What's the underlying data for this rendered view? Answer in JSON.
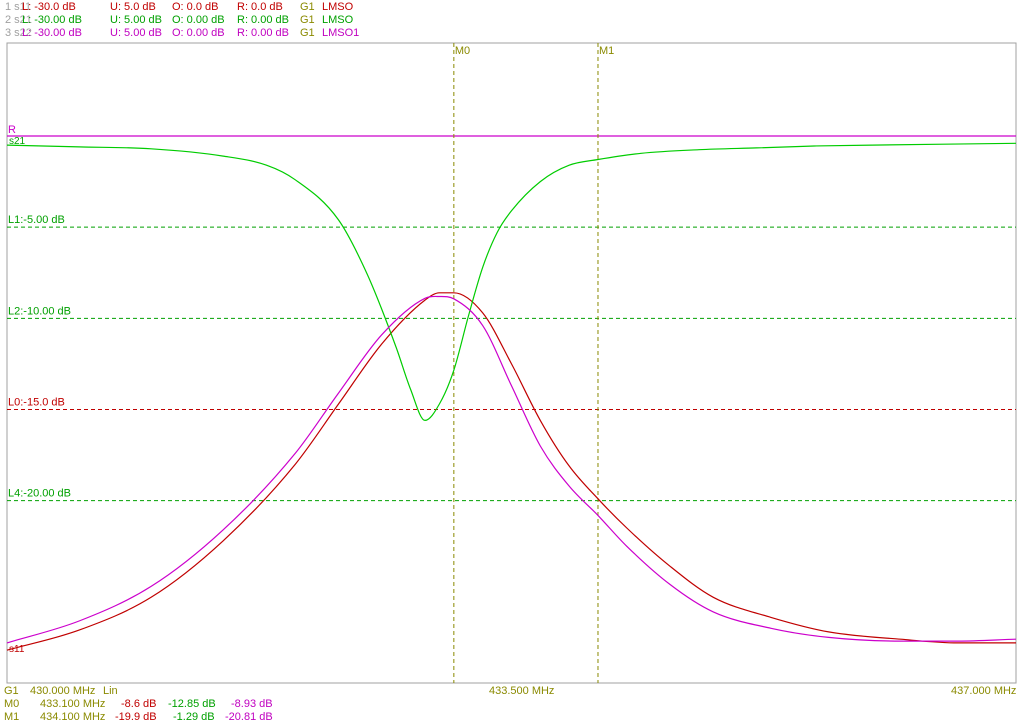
{
  "header": {
    "rows": [
      {
        "id": "1 s11",
        "L": "L: -30.0 dB",
        "U": "U: 5.0 dB",
        "O": "O: 0.0 dB",
        "R": "R: 0.0 dB",
        "G": "G1",
        "fmt": "LMSO"
      },
      {
        "id": "2 s21",
        "L": "L: -30.00 dB",
        "U": "U: 5.00 dB",
        "O": "O: 0.00 dB",
        "R": "R: 0.00 dB",
        "G": "G1",
        "fmt": "LMSO"
      },
      {
        "id": "3 s22",
        "L": "L: -30.00 dB",
        "U": "U: 5.00 dB",
        "O": "O: 0.00 dB",
        "R": "R: 0.00 dB",
        "G": "G1",
        "fmt": "LMSO1"
      }
    ]
  },
  "footer": {
    "graph": "G1",
    "start": "430.000 MHz",
    "scale": "Lin",
    "center": "433.500 MHz",
    "stop": "437.000 MHz",
    "markers": [
      {
        "name": "M0",
        "freq": "433.100 MHz",
        "v1": "-8.6 dB",
        "v2": "-12.85 dB",
        "v3": "-8.93 dB"
      },
      {
        "name": "M1",
        "freq": "434.100 MHz",
        "v1": "-19.9 dB",
        "v2": "-1.29 dB",
        "v3": "-20.81 dB"
      }
    ]
  },
  "colors": {
    "s11": "#c00000",
    "s21": "#00cc00",
    "s22": "#cc00cc",
    "marker": "#8a8a00",
    "grid_frame": "#a0a0a0",
    "L1": "#00a000",
    "L2": "#00a000",
    "L0": "#c00000",
    "L4": "#00a000",
    "R": "#cc00cc"
  },
  "chart_data": {
    "type": "line",
    "x_unit": "MHz",
    "xlim": [
      430.0,
      437.0
    ],
    "ylim": [
      -30,
      5
    ],
    "ref_label": "R",
    "trace_tags": [
      "s21",
      "s11"
    ],
    "ref_lines": [
      {
        "label": "L1:-5.00 dB",
        "y": -5,
        "color_key": "L1"
      },
      {
        "label": "L2:-10.00 dB",
        "y": -10,
        "color_key": "L2"
      },
      {
        "label": "L0:-15.0 dB",
        "y": -15,
        "color_key": "L0"
      },
      {
        "label": "L4:-20.00 dB",
        "y": -20,
        "color_key": "L4"
      }
    ],
    "ref_level": {
      "label": "R",
      "y": 0
    },
    "markers": [
      {
        "name": "M0",
        "x": 433.1
      },
      {
        "name": "M1",
        "x": 434.1
      }
    ],
    "series": [
      {
        "name": "s11",
        "x": [
          430.0,
          430.5,
          431.0,
          431.5,
          432.0,
          432.3,
          432.6,
          432.9,
          433.0,
          433.1,
          433.3,
          433.5,
          433.7,
          433.9,
          434.1,
          434.3,
          434.6,
          434.9,
          435.3,
          435.7,
          436.2,
          436.6,
          437.0
        ],
        "y": [
          -28.2,
          -27.1,
          -25.3,
          -22.2,
          -18.0,
          -14.7,
          -11.4,
          -9.0,
          -8.6,
          -8.6,
          -9.7,
          -12.5,
          -15.6,
          -18.1,
          -19.9,
          -21.5,
          -23.6,
          -25.3,
          -26.4,
          -27.2,
          -27.6,
          -27.8,
          -27.8
        ]
      },
      {
        "name": "s21",
        "x": [
          430.0,
          430.5,
          431.0,
          431.5,
          431.8,
          432.0,
          432.3,
          432.5,
          432.7,
          432.8,
          432.9,
          433.0,
          433.1,
          433.2,
          433.3,
          433.4,
          433.5,
          433.7,
          433.9,
          434.1,
          434.4,
          434.8,
          435.2,
          435.6,
          436.0,
          436.5,
          437.0
        ],
        "y": [
          -0.5,
          -0.6,
          -0.7,
          -1.1,
          -1.6,
          -2.4,
          -4.6,
          -7.6,
          -11.6,
          -13.9,
          -15.6,
          -14.7,
          -12.85,
          -9.9,
          -7.2,
          -5.3,
          -4.1,
          -2.5,
          -1.6,
          -1.29,
          -0.95,
          -0.75,
          -0.65,
          -0.55,
          -0.5,
          -0.45,
          -0.4
        ]
      },
      {
        "name": "s22",
        "x": [
          430.0,
          430.5,
          431.0,
          431.5,
          432.0,
          432.3,
          432.6,
          432.9,
          433.0,
          433.1,
          433.3,
          433.5,
          433.7,
          433.9,
          434.1,
          434.3,
          434.6,
          434.9,
          435.3,
          435.7,
          436.2,
          436.6,
          437.0
        ],
        "y": [
          -27.8,
          -26.6,
          -24.7,
          -21.6,
          -17.4,
          -14.1,
          -10.9,
          -8.9,
          -8.8,
          -8.93,
          -10.4,
          -13.7,
          -17.0,
          -19.2,
          -20.81,
          -22.5,
          -24.6,
          -26.1,
          -27.0,
          -27.5,
          -27.7,
          -27.7,
          -27.6
        ]
      }
    ]
  }
}
